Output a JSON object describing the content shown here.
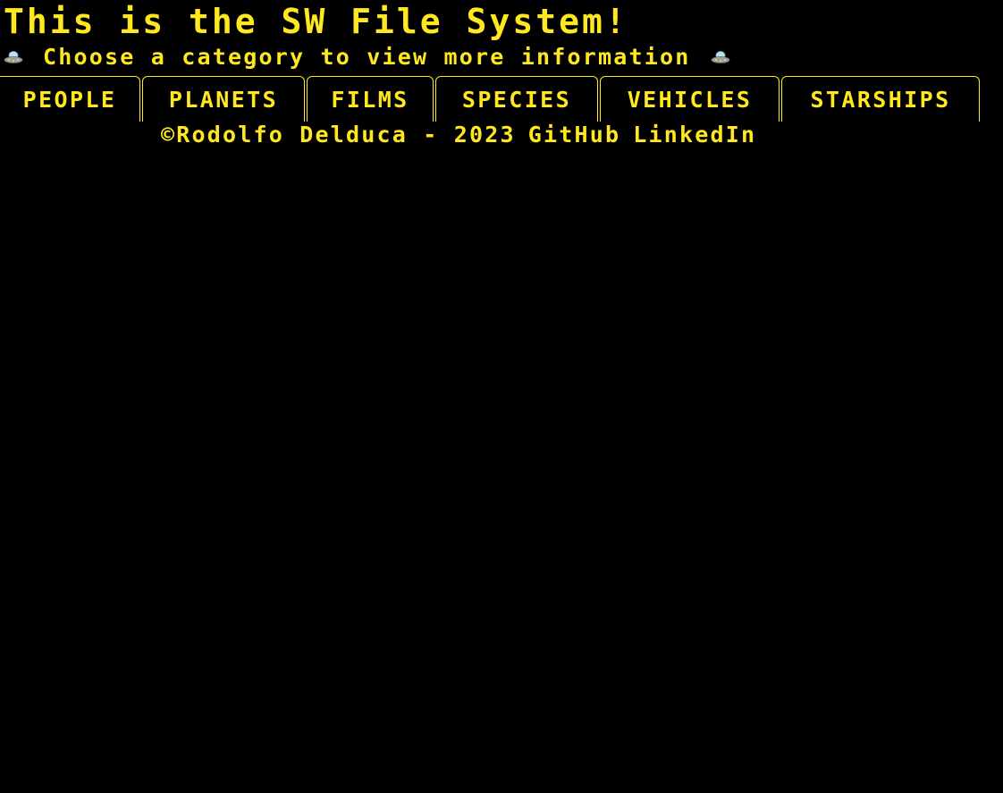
{
  "header": {
    "title": "This is the SW File System!",
    "subtitle": "Choose a category to view more information"
  },
  "icons": {
    "left": "ufo-icon",
    "right": "ufo-icon"
  },
  "tabs": [
    {
      "label": "PEOPLE"
    },
    {
      "label": "PLANETS"
    },
    {
      "label": "FILMS"
    },
    {
      "label": "SPECIES"
    },
    {
      "label": "VEHICLES"
    },
    {
      "label": "STARSHIPS"
    }
  ],
  "footer": {
    "copyright": "©Rodolfo Delduca - 2023",
    "links": [
      {
        "label": "GitHub"
      },
      {
        "label": "LinkedIn"
      }
    ]
  },
  "colors": {
    "background": "#000000",
    "accent": "#ffe81f"
  }
}
